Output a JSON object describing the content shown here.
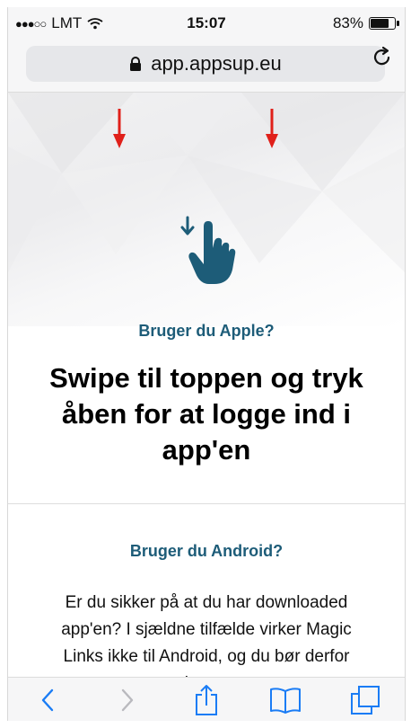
{
  "status_bar": {
    "carrier": "LMT",
    "time": "15:07",
    "battery": "83%",
    "battery_level": 0.83
  },
  "address_bar": {
    "url": "app.appsup.eu",
    "lock_icon": "lock-icon",
    "reload_icon": "reload-icon"
  },
  "hero": {
    "arrow_color": "#e0201a",
    "hand_color": "#1d5c78"
  },
  "content": {
    "apple_question": "Bruger du Apple?",
    "headline": "Swipe til toppen og tryk åben for at logge ind i app'en",
    "android_question": "Bruger du Android?",
    "android_text": "Er du sikker på at du har downloaded app'en? I sjældne tilfælde virker Magic Links ikke til Android, og du bør derfor bruge"
  },
  "toolbar": {
    "items": [
      "back-icon",
      "forward-icon",
      "share-icon",
      "bookmarks-icon",
      "tabs-icon"
    ],
    "accent": "#1a7cf5",
    "disabled": "#b9b9be"
  }
}
